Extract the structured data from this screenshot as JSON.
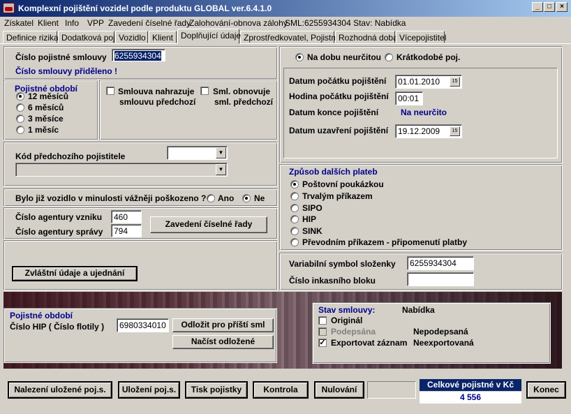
{
  "window": {
    "title": "Komplexní pojištění vozidel podle produktu GLOBAL ver.6.4.1.0"
  },
  "menu": [
    "Získatel",
    "Klient",
    "Info",
    "VPP",
    "Zavedení číselné řady",
    "Zalohování-obnova zálohy",
    "SML:6255934304 Stav: Nabídka"
  ],
  "tabs": [
    "Definice rizika",
    "Dodatková poj.",
    "Vozidlo",
    "Klient",
    "Doplňující údaje",
    "Zprostředkovatel, Pojistné",
    "Rozhodná doba",
    "Vícepojistitel"
  ],
  "contract": {
    "number_label": "Číslo pojistné smlouvy",
    "number_value": "6255934304",
    "assigned_msg": "Číslo smlouvy přiděleno !"
  },
  "period": {
    "title": "Pojistné období",
    "options": [
      "12 měsíců",
      "6 měsíců",
      "3 měsíce",
      "1 měsíc"
    ]
  },
  "checks": {
    "replace_line1": "Smlouva nahrazuje",
    "replace_line2": "smlouvu předchozí",
    "renew_line1": "Sml. obnovuje",
    "renew_line2": "sml. předchozí"
  },
  "prev_insurer": {
    "label": "Kód předchozího pojistitele",
    "code": "",
    "name": ""
  },
  "damage": {
    "question": "Bylo již vozidlo v minulosti vážněji poškozeno ?",
    "yes": "Ano",
    "no": "Ne"
  },
  "agency": {
    "origin_label": "Číslo agentury vzniku",
    "origin_value": "460",
    "admin_label": "Číslo agentury správy",
    "admin_value": "794",
    "series_button": "Zavedení číselné řady"
  },
  "special_button": "Zvláštní údaje a ujednání",
  "duration": {
    "indefinite": "Na dobu neurčitou",
    "short": "Krátkodobé poj."
  },
  "dates": {
    "start_label": "Datum počátku pojištění",
    "start_value": "01.01.2010",
    "hour_label": "Hodina počátku pojištění",
    "hour_value": "00:01",
    "end_label": "Datum konce pojištění",
    "end_value": "Na neurčito",
    "concl_label": "Datum uzavření pojištění",
    "concl_value": "19.12.2009",
    "cal_icon": "15"
  },
  "payment": {
    "title": "Způsob dalších plateb",
    "options": [
      "Poštovní poukázkou",
      "Trvalým příkazem",
      "SIPO",
      "HIP",
      "SINK",
      "Převodním příkazem - připomenutí platby"
    ]
  },
  "symbols": {
    "var_label": "Variabilní symbol složenky",
    "var_value": "6255934304",
    "block_label": "Číslo inkasního bloku",
    "block_value": ""
  },
  "hip": {
    "title": "Pojistné období",
    "label": "Číslo HIP ( Číslo flotily )",
    "value": "6980334010",
    "defer_button": "Odložit pro příští sml",
    "load_button": "Načíst odložené"
  },
  "status": {
    "label": "Stav smlouvy:",
    "value": "Nabídka",
    "original": "Originál",
    "signed": "Podepsána",
    "signed_state": "Nepodepsaná",
    "export": "Exportovat záznam",
    "export_state": "Neexportovaná"
  },
  "bottom": {
    "find": "Nalezení uložené poj.s.",
    "save": "Uložení poj.s.",
    "print": "Tisk pojistky",
    "check": "Kontrola",
    "reset": "Nulování",
    "total_label": "Celkové pojistné v Kč",
    "total_value": "4 556",
    "end": "Konec"
  }
}
